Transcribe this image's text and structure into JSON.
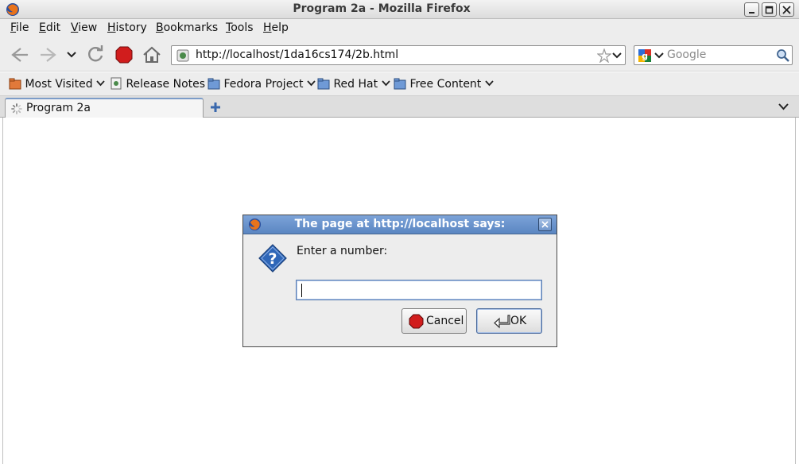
{
  "window": {
    "title": "Program 2a - Mozilla Firefox"
  },
  "menu": {
    "items": [
      "File",
      "Edit",
      "View",
      "History",
      "Bookmarks",
      "Tools",
      "Help"
    ]
  },
  "navigation": {
    "url": "http://localhost/1da16cs174/2b.html",
    "search_placeholder": "Google"
  },
  "bookmarks": {
    "items": [
      "Most Visited",
      "Release Notes",
      "Fedora Project",
      "Red Hat",
      "Free Content"
    ]
  },
  "tabs": {
    "active_label": "Program 2a"
  },
  "dialog": {
    "title": "The page at http://localhost says:",
    "message": "Enter a number:",
    "input_value": "",
    "cancel_label": "Cancel",
    "ok_label": "OK"
  },
  "colors": {
    "dialog_title_bg": "#6b93cc",
    "stop_red": "#d11d1d",
    "help_blue": "#2e66b8"
  }
}
